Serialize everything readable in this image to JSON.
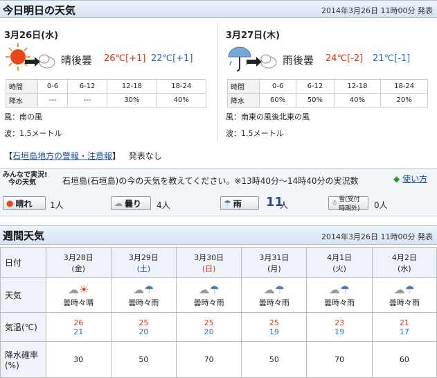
{
  "today_tomorrow": {
    "title": "今日明日の天気",
    "issued": "2014年3月26日 11時00分 発表"
  },
  "days": [
    {
      "date": "3月26日(水)",
      "icon": "sunny-then-cloudy-icon",
      "telop": "晴後曇",
      "high": "26℃[+1]",
      "low": "22℃[+1]",
      "periods": [
        "時間",
        "0-6",
        "6-12",
        "12-18",
        "18-24"
      ],
      "pop": [
        "降水",
        "---",
        "---",
        "30%",
        "40%"
      ],
      "wind": "風：南の風",
      "wave": "波：1.5メートル"
    },
    {
      "date": "3月27日(木)",
      "icon": "rain-then-cloudy-icon",
      "telop": "雨後曇",
      "high": "24℃[-2]",
      "low": "21℃[-1]",
      "periods": [
        "時間",
        "0-6",
        "6-12",
        "12-18",
        "18-24"
      ],
      "pop": [
        "降水",
        "60%",
        "50%",
        "40%",
        "20%"
      ],
      "wind": "風：南東の風後北東の風",
      "wave": "波：1.5メートル"
    }
  ],
  "warning": {
    "bracket_open": "【",
    "link": "石垣島地方の警報・注意報",
    "bracket_close": "】",
    "status": "発表なし"
  },
  "poll": {
    "logo_l1": "みんなで実況!",
    "logo_l2": "今の天気",
    "question": "石垣島(石垣島)の今の天気を教えてください。※13時40分～14時40分の実況数",
    "help": "使い方",
    "items": [
      {
        "label": "晴れ",
        "count": "1人"
      },
      {
        "label": "曇り",
        "count": "4人"
      },
      {
        "label": "雨",
        "count": "11",
        "unit": "人"
      },
      {
        "label": "雪(受付時期外)",
        "count": "0人"
      }
    ]
  },
  "weekly": {
    "title": "週間天気",
    "issued": "2014年3月26日 11時00分 発表",
    "row_labels": {
      "date": "日付",
      "weather": "天気",
      "temp": "気温(℃)",
      "pop": "降水確率(%)"
    },
    "days": [
      {
        "md": "3月28日",
        "dow": "(金)",
        "type": "",
        "icon": "cloudy-sometimes-sunny-icon",
        "telop": "曇時々晴",
        "high": "26",
        "low": "21",
        "pop": "30"
      },
      {
        "md": "3月29日",
        "dow": "(土)",
        "type": "sat",
        "icon": "cloudy-sometimes-rain-icon",
        "telop": "曇時々雨",
        "high": "25",
        "low": "20",
        "pop": "50"
      },
      {
        "md": "3月30日",
        "dow": "(日)",
        "type": "sun",
        "icon": "cloudy-sometimes-rain-icon",
        "telop": "曇時々雨",
        "high": "25",
        "low": "20",
        "pop": "70"
      },
      {
        "md": "3月31日",
        "dow": "(月)",
        "type": "",
        "icon": "cloudy-sometimes-rain-icon",
        "telop": "曇時々雨",
        "high": "25",
        "low": "19",
        "pop": "50"
      },
      {
        "md": "4月1日",
        "dow": "(火)",
        "type": "",
        "icon": "cloudy-sometimes-rain-icon",
        "telop": "曇時々雨",
        "high": "23",
        "low": "19",
        "pop": "70"
      },
      {
        "md": "4月2日",
        "dow": "(水)",
        "type": "",
        "icon": "cloudy-sometimes-rain-icon",
        "telop": "曇時々雨",
        "high": "21",
        "low": "17",
        "pop": "60"
      }
    ]
  },
  "colors": {
    "high": "#d9320f",
    "low": "#2a6aba",
    "header_bg": "#d6e3f2",
    "link": "#1a4fa0"
  }
}
